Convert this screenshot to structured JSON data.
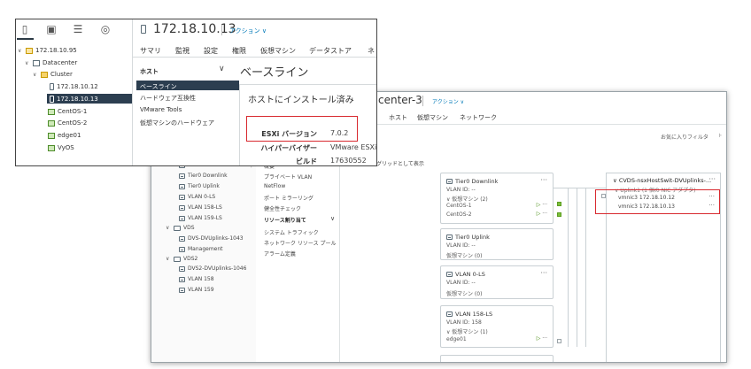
{
  "front": {
    "tree": [
      {
        "label": "172.18.10.95"
      },
      {
        "label": "Datacenter"
      },
      {
        "label": "Cluster"
      },
      {
        "label": "172.18.10.12"
      },
      {
        "label": "172.18.10.13"
      },
      {
        "label": "CentOS-1"
      },
      {
        "label": "CentOS-2"
      },
      {
        "label": "edge01"
      },
      {
        "label": "VyOS"
      }
    ],
    "title": "172.18.10.13",
    "actions": "アクション ∨",
    "tabs": [
      "サマリ",
      "監視",
      "設定",
      "権限",
      "仮想マシン",
      "データストア",
      "ネ"
    ],
    "side_heading": "ホスト",
    "side_items": [
      "ベースライン",
      "ハードウェア互換性",
      "VMware Tools",
      "仮想マシンのハードウェア"
    ],
    "main_title": "ベースライン",
    "panel": {
      "heading": "ホストにインストール済み",
      "esxi_label": "ESXi バージョン",
      "esxi_value": "7.0.2",
      "hv_label": "ハイパーバイザー",
      "hv_value": "VMware ESXi",
      "build_label": "ビルド",
      "build_value": "17630552"
    },
    "colors": {
      "selection": "#2c3e50",
      "link": "#0079b8",
      "highlight": "#d8292f"
    }
  },
  "back": {
    "title_fragment": "center-3",
    "actions": "アクション ∨",
    "tabs": [
      "ホスト",
      "仮想マシン",
      "ネットワーク"
    ],
    "favorites": "お気に入りフィルタ",
    "tree": [
      {
        "label": "CVDS-nsxHostSwit-DVUplinks-1041"
      },
      {
        "label": "Tier0 Downlink"
      },
      {
        "label": "Tier0 Uplink"
      },
      {
        "label": "VLAN 0-LS"
      },
      {
        "label": "VLAN 158-LS"
      },
      {
        "label": "VLAN 159-LS"
      },
      {
        "label": "VDS"
      },
      {
        "label": "DVS-DVUplinks-1043"
      },
      {
        "label": "Management"
      },
      {
        "label": "VDS2"
      },
      {
        "label": "DVS2-DVUplinks-1046"
      },
      {
        "label": "VLAN 158"
      },
      {
        "label": "VLAN 159"
      }
    ],
    "menu": {
      "items_top": [
        "概要",
        "プライベート VLAN",
        "NetFlow",
        "ポート ミラーリング",
        "健全性チェック"
      ],
      "section": "リソース割り当て",
      "items_bottom": [
        "システム トラフィック",
        "ネットワーク リソース プール",
        "アラーム定義"
      ]
    },
    "grid_label": "グリッドとして表示",
    "portgroups": [
      {
        "name": "Tier0 Downlink",
        "vlan": "VLAN ID: --",
        "vm_head": "∨ 仮想マシン (2)",
        "vms": [
          "CentOS-1",
          "CentOS-2"
        ]
      },
      {
        "name": "Tier0 Uplink",
        "vlan": "VLAN ID: --",
        "vm_head": "仮想マシン (0)",
        "vms": []
      },
      {
        "name": "VLAN 0-LS",
        "vlan": "VLAN ID: --",
        "vm_head": "仮想マシン (0)",
        "vms": []
      },
      {
        "name": "VLAN 158-LS",
        "vlan": "VLAN ID: 158",
        "vm_head": "∨ 仮想マシン (1)",
        "vms": [
          "edge01"
        ]
      }
    ],
    "switch": {
      "title": "∨ CVDS-nsxHostSwit-DVUplinks-...",
      "subtitle": "∨ Uplink1 (1 個の NIC アダプタ)",
      "uplinks": [
        "vmnic3 172.18.10.12",
        "vmnic3 172.18.10.13"
      ]
    }
  }
}
